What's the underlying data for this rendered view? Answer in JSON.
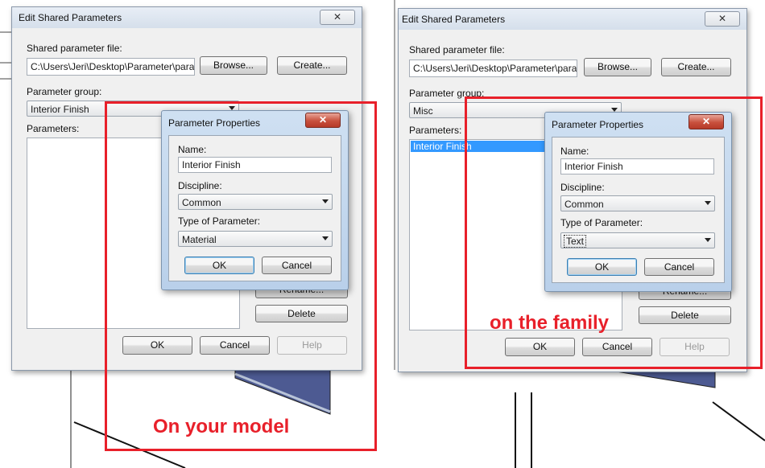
{
  "left": {
    "dialog_title": "Edit Shared Parameters",
    "close_label": "✕",
    "shared_file_label": "Shared parameter file:",
    "shared_file_value": "C:\\Users\\Jeri\\Desktop\\Parameter\\parame",
    "browse_label": "Browse...",
    "create_label": "Create...",
    "group_label": "Parameter group:",
    "group_value": "Interior Finish",
    "parameters_label": "Parameters:",
    "parameters_items": [],
    "rename_label": "Rename...",
    "delete_label": "Delete",
    "ok_label": "OK",
    "cancel_label": "Cancel",
    "help_label": "Help",
    "props": {
      "title": "Parameter Properties",
      "close_label": "✕",
      "name_label": "Name:",
      "name_value": "Interior Finish",
      "discipline_label": "Discipline:",
      "discipline_value": "Common",
      "type_label": "Type of Parameter:",
      "type_value": "Material",
      "ok_label": "OK",
      "cancel_label": "Cancel"
    },
    "annotation": "On your model"
  },
  "right": {
    "dialog_title": "Edit Shared Parameters",
    "close_label": "✕",
    "shared_file_label": "Shared parameter file:",
    "shared_file_value": "C:\\Users\\Jeri\\Desktop\\Parameter\\parame",
    "browse_label": "Browse...",
    "create_label": "Create...",
    "group_label": "Parameter group:",
    "group_value": "Misc",
    "parameters_label": "Parameters:",
    "parameters_items": [
      "Interior Finish"
    ],
    "rename_label": "Rename...",
    "delete_label": "Delete",
    "ok_label": "OK",
    "cancel_label": "Cancel",
    "help_label": "Help",
    "props": {
      "title": "Parameter Properties",
      "close_label": "✕",
      "name_label": "Name:",
      "name_value": "Interior Finish",
      "discipline_label": "Discipline:",
      "discipline_value": "Common",
      "type_label": "Type of Parameter:",
      "type_value": "Text",
      "ok_label": "OK",
      "cancel_label": "Cancel"
    },
    "annotation": "on the family"
  },
  "colors": {
    "annotation_red": "#e8202a",
    "selection_blue": "#3399ff"
  },
  "icons": {
    "close": "close-icon",
    "dropdown": "chevron-down-icon"
  }
}
